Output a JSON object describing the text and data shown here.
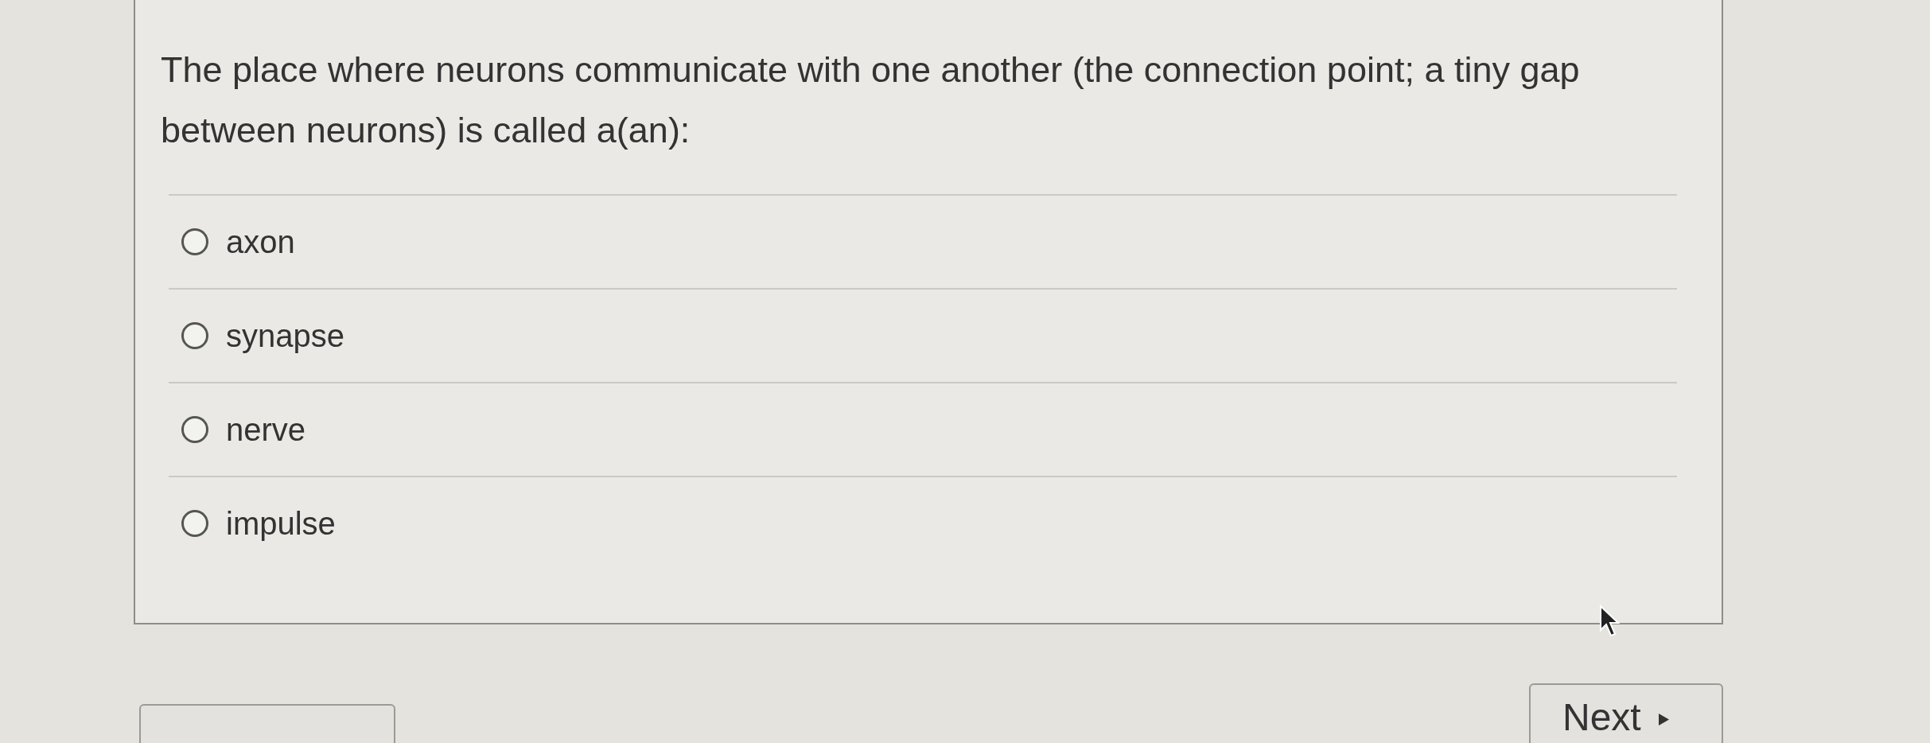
{
  "question": {
    "text": "The place where neurons communicate with one another (the connection point; a tiny gap between neurons) is called a(an):"
  },
  "options": [
    {
      "label": "axon",
      "selected": false
    },
    {
      "label": "synapse",
      "selected": false
    },
    {
      "label": "nerve",
      "selected": false
    },
    {
      "label": "impulse",
      "selected": false
    }
  ],
  "next_button": {
    "label": "Next"
  }
}
